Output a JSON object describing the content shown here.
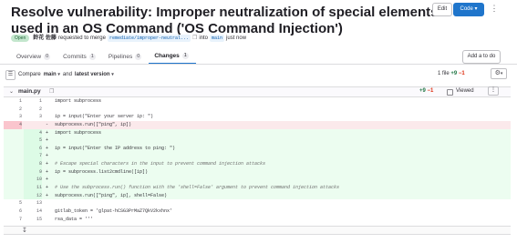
{
  "mr": {
    "title": "Resolve vulnerability: Improper neutralization of special elements used in an OS Command ('OS Command Injection')",
    "status": "Open",
    "author": "鈴花 佐藤",
    "requested_text": "requested to merge",
    "source_branch": "remediate/improper-neutral...",
    "into_text": "into",
    "target_branch": "main",
    "time": "just now"
  },
  "header_buttons": {
    "edit": "Edit",
    "code": "Code",
    "more": "⋮"
  },
  "todo_button": "Add a to do",
  "tabs": [
    {
      "label": "Overview",
      "count": "0"
    },
    {
      "label": "Commits",
      "count": "1"
    },
    {
      "label": "Pipelines",
      "count": "0"
    },
    {
      "label": "Changes",
      "count": "1"
    }
  ],
  "compare": {
    "label": "Compare",
    "branch": "main",
    "and_text": "and",
    "version": "latest version"
  },
  "file_stats": {
    "files": "1 file",
    "additions": "+9",
    "deletions": "−1"
  },
  "file": {
    "name": "main.py",
    "additions": "+9",
    "deletions": "−1",
    "viewed_label": "Viewed",
    "more": "⋮"
  },
  "diff": [
    {
      "type": "ctx",
      "old": "1",
      "new": "1",
      "marker": "",
      "text": "import subprocess"
    },
    {
      "type": "ctx",
      "old": "2",
      "new": "2",
      "marker": "",
      "text": ""
    },
    {
      "type": "ctx",
      "old": "3",
      "new": "3",
      "marker": "",
      "text": "ip = input(\"Enter your server ip: \")"
    },
    {
      "type": "del",
      "old": "4",
      "new": "",
      "marker": "-",
      "text": "subprocess.run([\"ping\", ip])"
    },
    {
      "type": "add",
      "old": "",
      "new": "4",
      "marker": "+",
      "text": "import subprocess"
    },
    {
      "type": "add",
      "old": "",
      "new": "5",
      "marker": "+",
      "text": ""
    },
    {
      "type": "add",
      "old": "",
      "new": "6",
      "marker": "+",
      "text": "ip = input(\"Enter the IP address to ping: \")"
    },
    {
      "type": "add",
      "old": "",
      "new": "7",
      "marker": "+",
      "text": ""
    },
    {
      "type": "add",
      "old": "",
      "new": "8",
      "marker": "+",
      "text": "# Escape special characters in the input to prevent command injection attacks"
    },
    {
      "type": "add",
      "old": "",
      "new": "9",
      "marker": "+",
      "text": "ip = subprocess.list2cmdline([ip])"
    },
    {
      "type": "add",
      "old": "",
      "new": "10",
      "marker": "+",
      "text": ""
    },
    {
      "type": "add",
      "old": "",
      "new": "11",
      "marker": "+",
      "text": "# Use the subprocess.run() function with the 'shell=False' argument to prevent command injection attacks"
    },
    {
      "type": "add",
      "old": "",
      "new": "12",
      "marker": "+",
      "text": "subprocess.run([\"ping\", ip], shell=False)"
    },
    {
      "type": "ctx",
      "old": "5",
      "new": "13",
      "marker": "",
      "text": ""
    },
    {
      "type": "ctx",
      "old": "6",
      "new": "14",
      "marker": "",
      "text": "gitlab_token = 'glpat-hCSG3PrMaZ7QkV2kxhnx'"
    },
    {
      "type": "ctx",
      "old": "7",
      "new": "15",
      "marker": "",
      "text": "rsa_data = '''"
    }
  ],
  "colors": {
    "accent": "#1f75cb",
    "added_bg": "#ecfdf0",
    "removed_bg": "#fbe9eb",
    "open_badge": "#c3e6cd"
  },
  "icons": [
    "copy-icon",
    "sidebar-toggle-icon",
    "gear-icon",
    "chevron-down-icon",
    "expand-icon"
  ]
}
